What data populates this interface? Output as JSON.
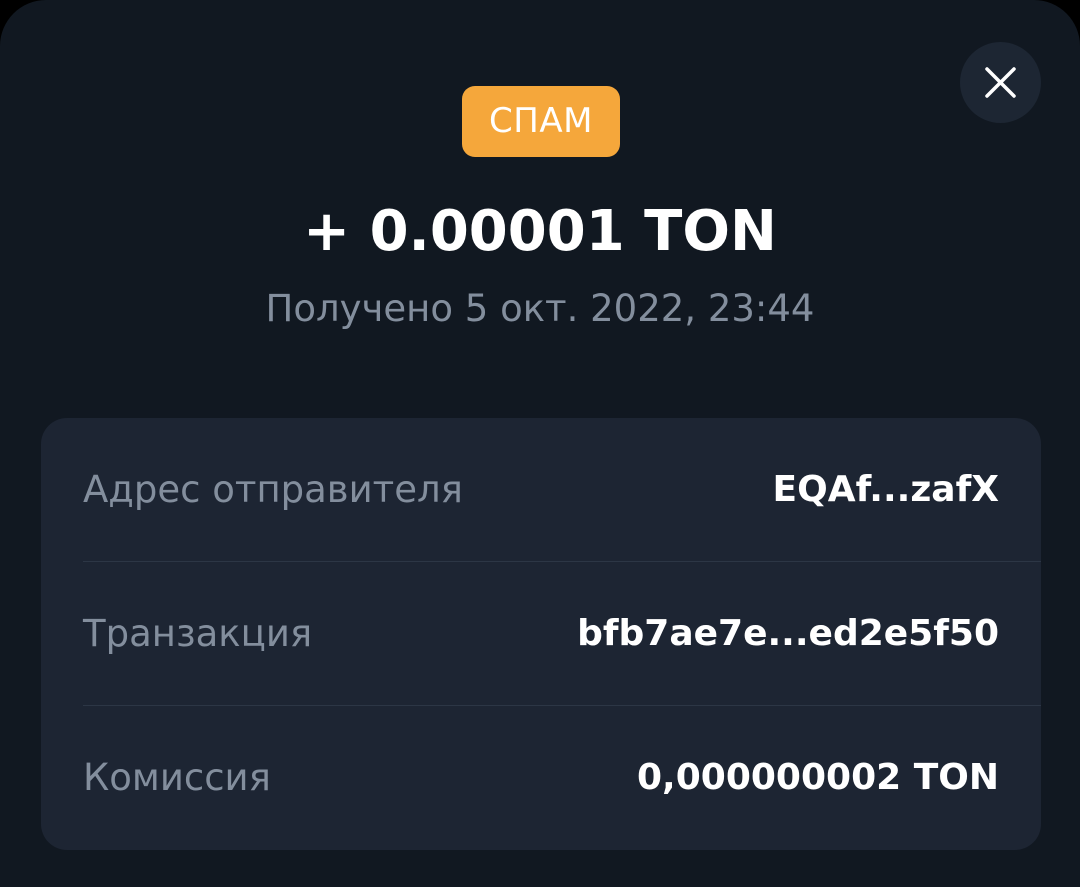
{
  "badge": {
    "label": "СПАМ",
    "color": "#f5a73b"
  },
  "amount": "+ 0.00001 TON",
  "received": "Получено 5 окт. 2022, 23:44",
  "close_icon": "close-icon",
  "details": [
    {
      "label": "Адрес отправителя",
      "value": "EQAf...zafX"
    },
    {
      "label": "Транзакция",
      "value": "bfb7ae7e...ed2e5f50"
    },
    {
      "label": "Комиссия",
      "value": "0,000000002 TON"
    }
  ],
  "colors": {
    "background": "#111821",
    "card": "#1d2533",
    "muted_text": "#838e9d",
    "primary_text": "#ffffff"
  }
}
